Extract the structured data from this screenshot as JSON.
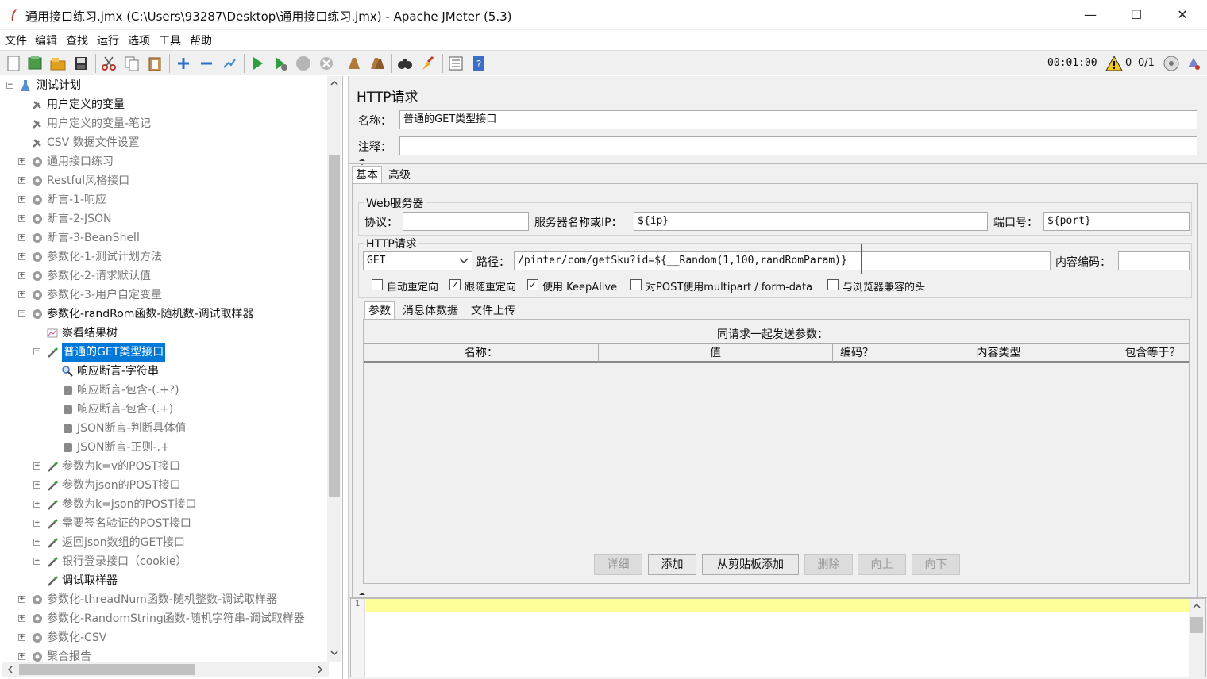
{
  "window": {
    "title": "通用接口练习.jmx (C:\\Users\\93287\\Desktop\\通用接口练习.jmx) - Apache JMeter (5.3)",
    "minimize": "—",
    "maximize": "☐",
    "close": "✕"
  },
  "menu": [
    "文件",
    "编辑",
    "查找",
    "运行",
    "选项",
    "工具",
    "帮助"
  ],
  "toolbar": {
    "timer": "00:01:00",
    "warnings": "0",
    "threads": "0/1"
  },
  "tree": {
    "root": "测试计划",
    "items": [
      {
        "label": "用户定义的变量",
        "icon": "wrench-icon"
      },
      {
        "label": "用户定义的变量-笔记",
        "icon": "wrench-icon"
      },
      {
        "label": "CSV 数据文件设置",
        "icon": "wrench-icon"
      },
      {
        "label": "通用接口练习",
        "icon": "gear-icon"
      },
      {
        "label": "Restful风格接口",
        "icon": "gear-icon"
      },
      {
        "label": "断言-1-响应",
        "icon": "gear-icon"
      },
      {
        "label": "断言-2-JSON",
        "icon": "gear-icon"
      },
      {
        "label": "断言-3-BeanShell",
        "icon": "gear-icon"
      },
      {
        "label": "参数化-1-测试计划方法",
        "icon": "gear-icon"
      },
      {
        "label": "参数化-2-请求默认值",
        "icon": "gear-icon"
      },
      {
        "label": "参数化-3-用户自定变量",
        "icon": "gear-icon"
      },
      {
        "label": "参数化-randRom函数-随机数-调试取样器",
        "icon": "gear-icon"
      },
      {
        "label": "察看结果树",
        "icon": "chart-icon"
      },
      {
        "label": "普通的GET类型接口",
        "icon": "pipette-icon"
      },
      {
        "label": "响应断言-字符串",
        "icon": "magnifier-icon"
      },
      {
        "label": "响应断言-包含-(.+?)",
        "icon": "assertion-icon"
      },
      {
        "label": "响应断言-包含-(.+)",
        "icon": "assertion-icon"
      },
      {
        "label": "JSON断言-判断具体值",
        "icon": "assertion-icon"
      },
      {
        "label": "JSON断言-正则-.+",
        "icon": "assertion-icon"
      },
      {
        "label": "参数为k=v的POST接口",
        "icon": "pipette-icon"
      },
      {
        "label": "参数为json的POST接口",
        "icon": "pipette-icon"
      },
      {
        "label": "参数为k=json的POST接口",
        "icon": "pipette-icon"
      },
      {
        "label": "需要签名验证的POST接口",
        "icon": "pipette-icon"
      },
      {
        "label": "返回json数组的GET接口",
        "icon": "pipette-icon"
      },
      {
        "label": "银行登录接口（cookie）",
        "icon": "pipette-icon"
      },
      {
        "label": "调试取样器",
        "icon": "pipette-icon"
      },
      {
        "label": "参数化-threadNum函数-随机整数-调试取样器",
        "icon": "gear-icon"
      },
      {
        "label": "参数化-RandomString函数-随机字符串-调试取样器",
        "icon": "gear-icon"
      },
      {
        "label": "参数化-CSV",
        "icon": "gear-icon"
      },
      {
        "label": "聚合报告",
        "icon": "gear-icon"
      }
    ]
  },
  "panel": {
    "heading": "HTTP请求",
    "name_label": "名称：",
    "name_value": "普通的GET类型接口",
    "comment_label": "注释：",
    "comment_value": "",
    "tabs": [
      "基本",
      "高级"
    ],
    "web_server": {
      "group_label": "Web服务器",
      "protocol_label": "协议：",
      "protocol_value": "",
      "server_label": "服务器名称或IP：",
      "server_value": "${ip}",
      "port_label": "端口号：",
      "port_value": "${port}"
    },
    "http_request": {
      "group_label": "HTTP请求",
      "method": "GET",
      "path_label": "路径：",
      "path_value": "/pinter/com/getSku?id=${__Random(1,100,randRomParam)}",
      "encoding_label": "内容编码：",
      "encoding_value": ""
    },
    "options": [
      {
        "label": "自动重定向",
        "checked": false
      },
      {
        "label": "跟随重定向",
        "checked": true
      },
      {
        "label": "使用 KeepAlive",
        "checked": true
      },
      {
        "label": "对POST使用multipart / form-data",
        "checked": false
      },
      {
        "label": "与浏览器兼容的头",
        "checked": false
      }
    ],
    "param_tabs": [
      "参数",
      "消息体数据",
      "文件上传"
    ],
    "params_caption": "同请求一起发送参数：",
    "columns": [
      "名称：",
      "值",
      "编码？",
      "内容类型",
      "包含等于？"
    ],
    "buttons": [
      {
        "label": "详细",
        "enabled": false
      },
      {
        "label": "添加",
        "enabled": true
      },
      {
        "label": "从剪贴板添加",
        "enabled": true
      },
      {
        "label": "删除",
        "enabled": false
      },
      {
        "label": "向上",
        "enabled": false
      },
      {
        "label": "向下",
        "enabled": false
      }
    ]
  },
  "log": {
    "line_number": "1"
  }
}
